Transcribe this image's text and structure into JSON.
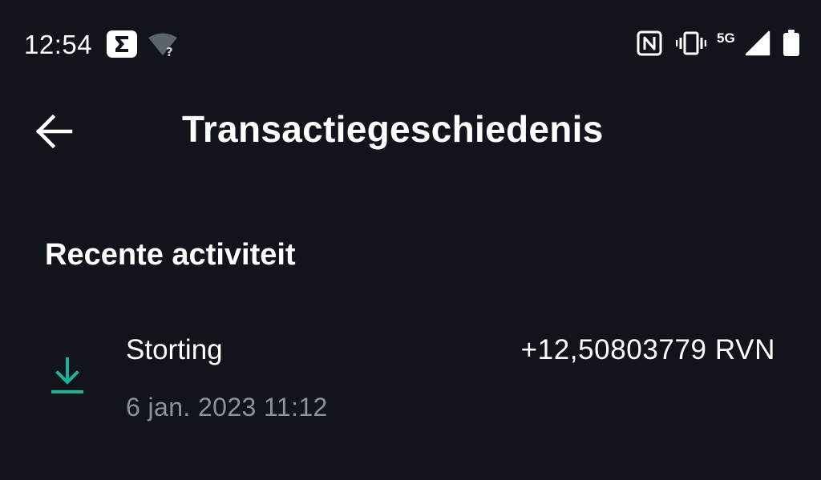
{
  "status_bar": {
    "time": "12:54",
    "network": "5G"
  },
  "app_bar": {
    "title": "Transactiegeschiedenis"
  },
  "section": {
    "title": "Recente activiteit"
  },
  "transactions": [
    {
      "type": "Storting",
      "amount": "+12,50803779 RVN",
      "date": "6 jan. 2023 11:12",
      "icon": "download-icon"
    }
  ],
  "colors": {
    "background": "#11151b",
    "accent": "#1ab39a",
    "secondary_text": "#8a929c"
  }
}
